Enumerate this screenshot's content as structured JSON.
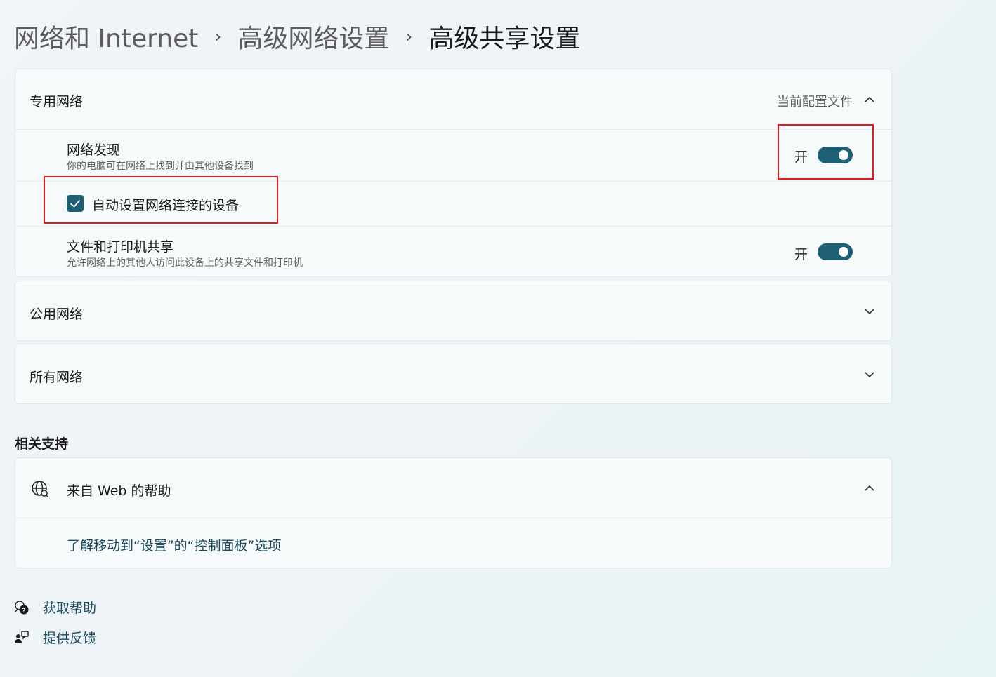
{
  "breadcrumb": {
    "level1": "网络和 Internet",
    "level2": "高级网络设置",
    "current": "高级共享设置",
    "separator": "›"
  },
  "private_network": {
    "title": "专用网络",
    "status": "当前配置文件",
    "expand_icon": "chevron-up-icon",
    "network_discovery": {
      "title": "网络发现",
      "description": "你的电脑可在网络上找到并由其他设备找到",
      "toggle_label": "开",
      "toggle_on": true
    },
    "auto_setup": {
      "label": "自动设置网络连接的设备",
      "checked": true
    },
    "file_printer_sharing": {
      "title": "文件和打印机共享",
      "description": "允许网络上的其他人访问此设备上的共享文件和打印机",
      "toggle_label": "开",
      "toggle_on": true
    }
  },
  "public_network": {
    "title": "公用网络",
    "expand_icon": "chevron-down-icon"
  },
  "all_networks": {
    "title": "所有网络",
    "expand_icon": "chevron-down-icon"
  },
  "related_support": {
    "heading": "相关支持",
    "web_help": {
      "title": "来自 Web 的帮助",
      "icon": "globe-icon",
      "expand_icon": "chevron-up-icon",
      "link": "了解移动到“设置”的“控制面板”选项"
    }
  },
  "footer_links": {
    "get_help": "获取帮助",
    "feedback": "提供反馈"
  },
  "colors": {
    "accent": "#1f5f73",
    "highlight_box": "#e01e1e",
    "link": "#1a4a5e"
  }
}
